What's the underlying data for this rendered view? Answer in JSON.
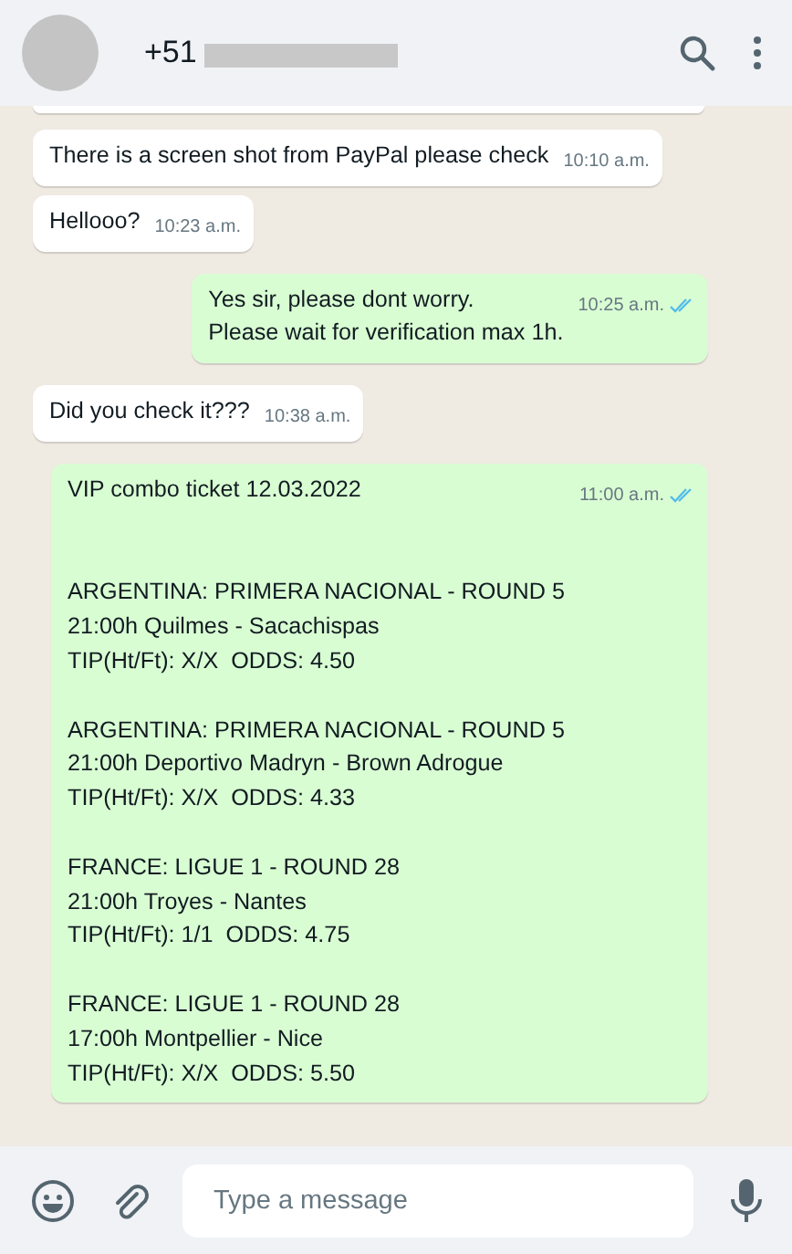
{
  "header": {
    "contact_name": "+51",
    "name_redacted": true
  },
  "messages": [
    {
      "outgoing": false,
      "text": "There is a screen shot from PayPal please check",
      "time": "10:10 a.m."
    },
    {
      "outgoing": false,
      "text": "Hellooo?",
      "time": "10:23 a.m."
    },
    {
      "outgoing": true,
      "text": "Yes sir, please dont worry.\nPlease wait for verification max 1h.",
      "time": "10:25 a.m.",
      "read": true
    },
    {
      "outgoing": false,
      "text": "Did you check it???",
      "time": "10:38 a.m."
    },
    {
      "outgoing": true,
      "text": "VIP combo ticket 12.03.2022\n\n\nARGENTINA: PRIMERA NACIONAL - ROUND 5\n21:00h Quilmes - Sacachispas\nTIP(Ht/Ft): X/X  ODDS: 4.50\n\nARGENTINA: PRIMERA NACIONAL - ROUND 5\n21:00h Deportivo Madryn - Brown Adrogue\nTIP(Ht/Ft): X/X  ODDS: 4.33\n\nFRANCE: LIGUE 1 - ROUND 28\n21:00h Troyes - Nantes\nTIP(Ht/Ft): 1/1  ODDS: 4.75\n\nFRANCE: LIGUE 1 - ROUND 28\n17:00h Montpellier - Nice\nTIP(Ht/Ft): X/X  ODDS: 5.50",
      "time": "11:00 a.m.",
      "read": true
    }
  ],
  "composer": {
    "placeholder": "Type a message"
  }
}
